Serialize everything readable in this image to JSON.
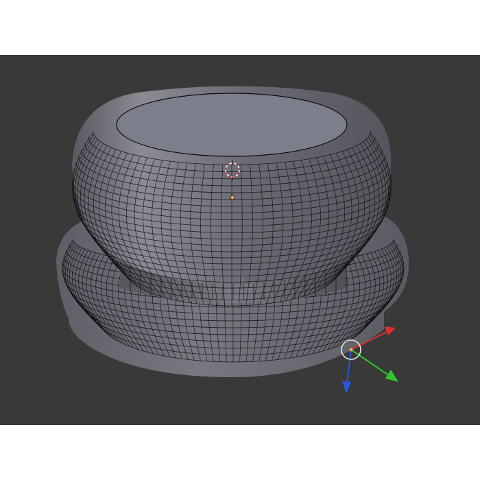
{
  "viewport": {
    "background_color": "#393939",
    "mesh_face_color": "#6d6e76",
    "mesh_wire_color": "#0c0c10",
    "top_face_color": "#7c7e8c",
    "object_origin_color": "#f5a64a",
    "cursor_color": "#cc3333"
  },
  "gizmo": {
    "x_axis_color": "#e03030",
    "y_axis_color": "#2ec52e",
    "z_axis_color": "#2a55e0",
    "ring_color": "#e8e8e8",
    "icon": "transform-manipulator-icon"
  },
  "mesh_object": {
    "icon": "cabinet-knob-mesh",
    "parts": [
      "top-dome",
      "stem",
      "base-flange"
    ]
  }
}
